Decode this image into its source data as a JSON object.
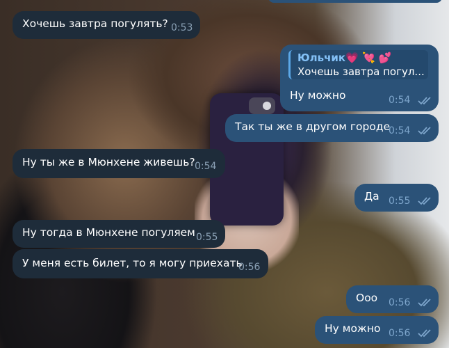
{
  "messages": [
    {
      "text": "Хочешь завтра погулять?",
      "time": "0:53"
    },
    {
      "reply_name": "Юльчик💗 💘 💕",
      "reply_text": "Хочешь завтра погул...",
      "text": "Ну можно",
      "time": "0:54"
    },
    {
      "text": "Так ты же в другом городе",
      "time": "0:54"
    },
    {
      "text": "Ну ты же в Мюнхене живешь?",
      "time": "0:54"
    },
    {
      "text": "Да",
      "time": "0:55"
    },
    {
      "text": "Ну тогда в Мюнхене погуляем",
      "time": "0:55"
    },
    {
      "text": "У меня есть билет, то я могу приехать",
      "time": "0:56"
    },
    {
      "text": "Ооо",
      "time": "0:56"
    },
    {
      "text": "Ну можно",
      "time": "0:56"
    }
  ],
  "colors": {
    "incoming_bubble": "#1e2c3a",
    "outgoing_bubble": "#2b5278",
    "reply_name": "#84c1f7",
    "read_ticks": "#7ea6cc"
  },
  "icons": {
    "read_status": "double-check-icon"
  }
}
